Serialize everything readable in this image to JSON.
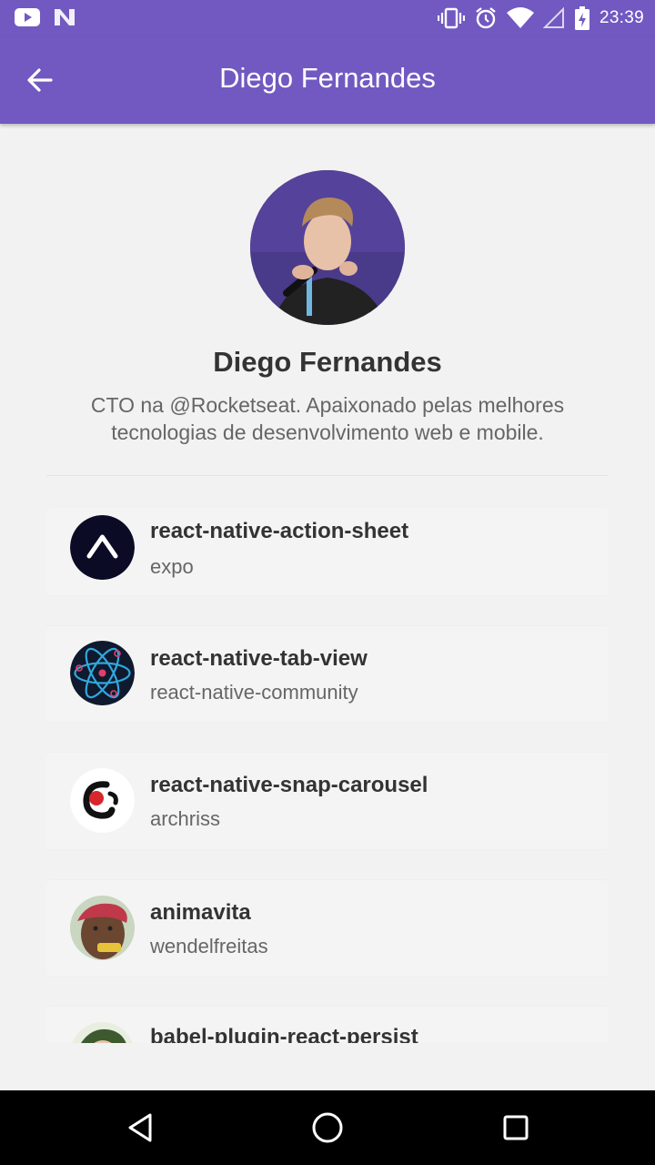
{
  "status_bar": {
    "time": "23:39",
    "left_icons": [
      "youtube-icon",
      "n-icon"
    ],
    "right_icons": [
      "vibrate-icon",
      "alarm-icon",
      "wifi-icon",
      "signal-icon",
      "battery-icon"
    ]
  },
  "app_bar": {
    "title": "Diego Fernandes",
    "back_icon": "arrow-left-icon",
    "background": "#7159c1"
  },
  "profile": {
    "name": "Diego Fernandes",
    "bio": "CTO na @Rocketseat. Apaixonado pelas melhores tecnologias de desenvolvimento web e mobile."
  },
  "repositories": [
    {
      "name": "react-native-action-sheet",
      "owner": "expo",
      "logo": "expo-logo"
    },
    {
      "name": "react-native-tab-view",
      "owner": "react-native-community",
      "logo": "react-logo"
    },
    {
      "name": "react-native-snap-carousel",
      "owner": "archriss",
      "logo": "archriss-logo"
    },
    {
      "name": "animavita",
      "owner": "wendelfreitas",
      "logo": "avatar-photo"
    },
    {
      "name": "babel-plugin-react-persist",
      "owner": "",
      "logo": "avatar-photo"
    }
  ],
  "nav_bar": {
    "icons": [
      "back-triangle-icon",
      "home-circle-icon",
      "recents-square-icon"
    ]
  }
}
